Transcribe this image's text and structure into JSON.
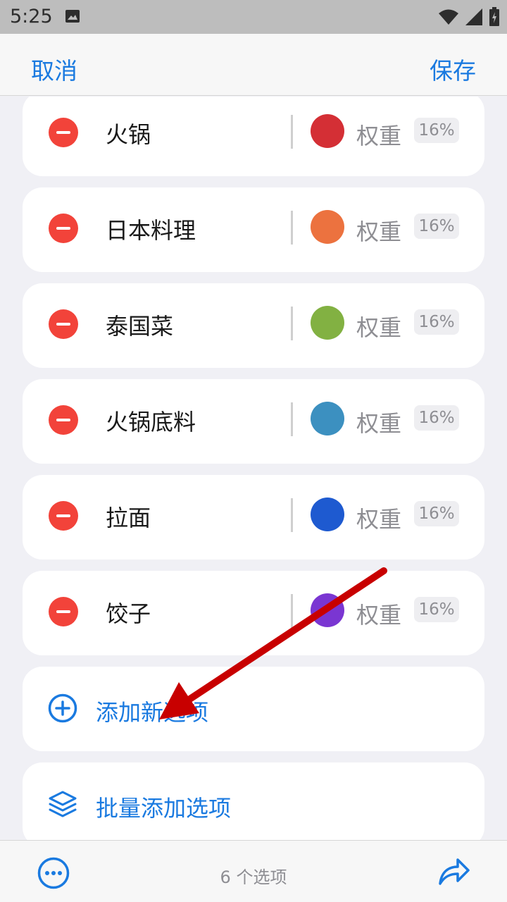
{
  "status_bar": {
    "time": "5:25"
  },
  "nav": {
    "cancel_label": "取消",
    "save_label": "保存"
  },
  "items": [
    {
      "name": "火锅",
      "color": "#d42f35",
      "weight_label": "权重",
      "weight": "16%"
    },
    {
      "name": "日本料理",
      "color": "#ec723f",
      "weight_label": "权重",
      "weight": "16%"
    },
    {
      "name": "泰国菜",
      "color": "#82b142",
      "weight_label": "权重",
      "weight": "16%"
    },
    {
      "name": "火锅底料",
      "color": "#3c90c0",
      "weight_label": "权重",
      "weight": "16%"
    },
    {
      "name": "拉面",
      "color": "#1e5ad0",
      "weight_label": "权重",
      "weight": "16%"
    },
    {
      "name": "饺子",
      "color": "#7a36d2",
      "weight_label": "权重",
      "weight": "16%"
    }
  ],
  "actions": {
    "add_option": "添加新选项",
    "bulk_add": "批量添加选项"
  },
  "bottom_bar": {
    "count": "6 个选项"
  },
  "colors": {
    "accent": "#1a7ae0",
    "remove": "#f2433a",
    "annotation": "#c80000"
  }
}
